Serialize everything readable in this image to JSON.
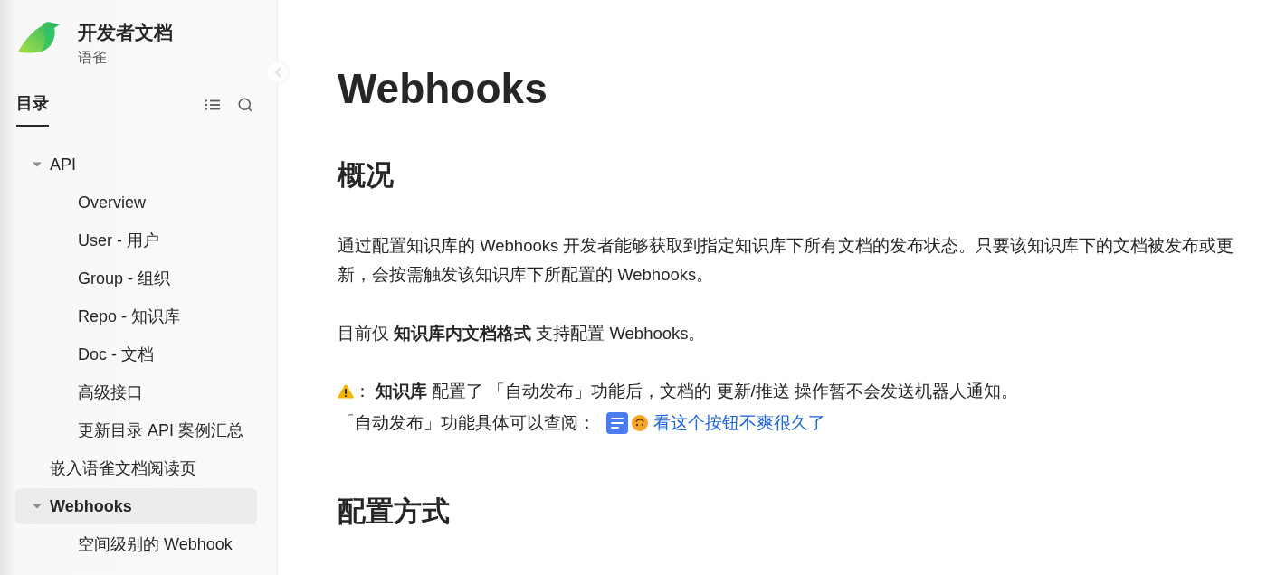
{
  "sidebar": {
    "title": "开发者文档",
    "subtitle": "语雀",
    "tabs": [
      {
        "label": "目录",
        "selected": true
      }
    ],
    "tree": [
      {
        "label": "API",
        "expanded": true,
        "selected": false,
        "children": [
          {
            "label": "Overview",
            "selected": false
          },
          {
            "label": "User - 用户",
            "selected": false
          },
          {
            "label": "Group - 组织",
            "selected": false
          },
          {
            "label": "Repo - 知识库",
            "selected": false
          },
          {
            "label": "Doc - 文档",
            "selected": false
          },
          {
            "label": "高级接口",
            "selected": false
          },
          {
            "label": "更新目录 API 案例汇总",
            "selected": false
          }
        ]
      },
      {
        "label": "嵌入语雀文档阅读页",
        "selected": false
      },
      {
        "label": "Webhooks",
        "expanded": true,
        "selected": true,
        "children": [
          {
            "label": "空间级别的 Webhook",
            "selected": false
          }
        ]
      }
    ]
  },
  "document": {
    "title": "Webhooks",
    "blocks": [
      {
        "kind": "heading",
        "text": "概况"
      },
      {
        "kind": "paragraph",
        "text": "通过配置知识库的 Webhooks 开发者能够获取到指定知识库下所有文档的发布状态。只要该知识库下的文档被发布或更新，会按需触发该知识库下所配置的 Webhooks。"
      },
      {
        "kind": "paragraph",
        "text": "目前仅 **知识库内文档格式** 支持配置 Webhooks。"
      },
      {
        "kind": "callout",
        "text": "： **知识库** 配置了 「自动发布」功能后，文档的 更新/推送 操作暂不会发送机器人通知。",
        "reference": "「自动发布」功能具体可以查阅：",
        "link": "看这个按钮不爽很久了"
      },
      {
        "kind": "heading",
        "text": "配置方式"
      }
    ]
  }
}
